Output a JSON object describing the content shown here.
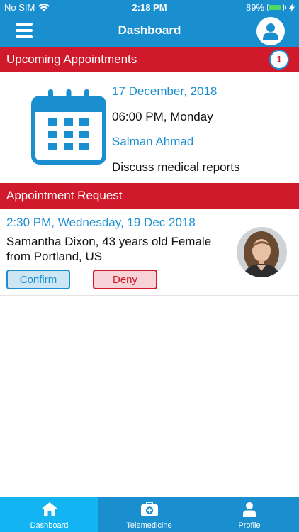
{
  "status_bar": {
    "carrier": "No SIM",
    "time": "2:18 PM",
    "battery": "89%",
    "battery_level": 0.89
  },
  "nav": {
    "title": "Dashboard"
  },
  "upcoming": {
    "header": "Upcoming Appointments",
    "count": "1",
    "date": "17 December, 2018",
    "time": "06:00 PM, Monday",
    "doctor": "Salman Ahmad",
    "note": "Discuss medical reports"
  },
  "request": {
    "header": "Appointment Request",
    "when": "2:30 PM, Wednesday, 19 Dec 2018",
    "who": "Samantha Dixon, 43 years old Female from Portland, US",
    "confirm_label": "Confirm",
    "deny_label": "Deny"
  },
  "tabs": [
    {
      "label": "Dashboard",
      "icon": "home-icon",
      "active": true
    },
    {
      "label": "Telemedicine",
      "icon": "medical-kit-icon",
      "active": false
    },
    {
      "label": "Profile",
      "icon": "person-icon",
      "active": false
    }
  ],
  "colors": {
    "primary": "#1a8fd0",
    "accent": "#d1192c",
    "active_tab": "#12b5f2"
  }
}
